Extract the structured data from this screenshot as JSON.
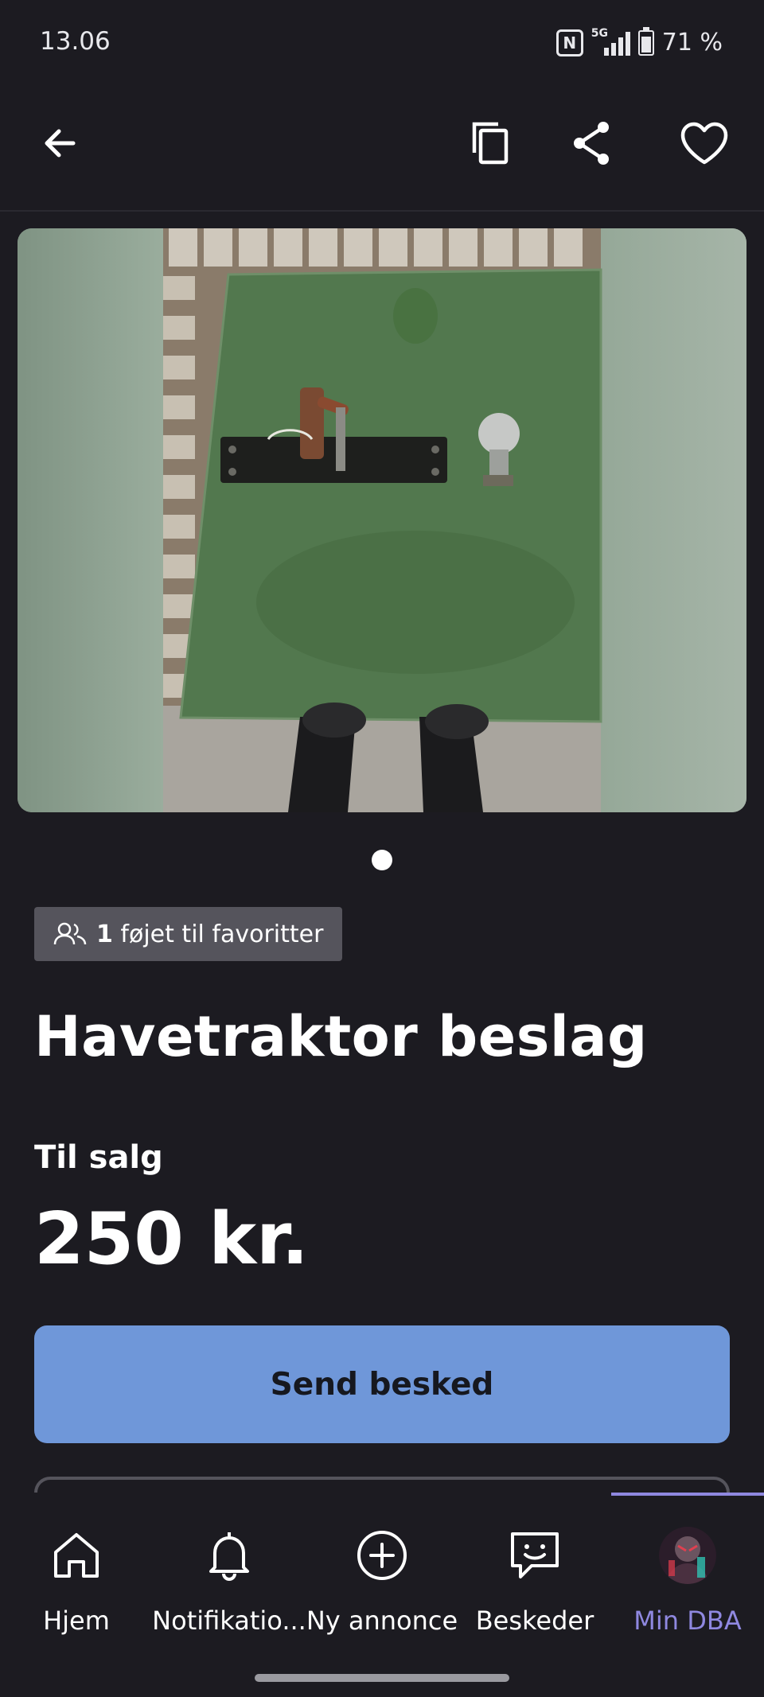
{
  "status_bar": {
    "time": "13.06",
    "network": "5G",
    "battery": "71 %",
    "battery_level_percent": 71
  },
  "toolbar": {
    "icons": [
      "back-arrow-icon",
      "copy-icon",
      "share-icon",
      "heart-icon"
    ]
  },
  "gallery": {
    "image_count": 1,
    "current_index": 1
  },
  "listing": {
    "favorites_count": "1",
    "favorites_text": "føjet til favoritter",
    "title": "Havetraktor beslag",
    "status": "Til salg",
    "price": "250 kr."
  },
  "actions": {
    "send_message": "Send besked"
  },
  "bottom_nav": {
    "items": [
      {
        "label": "Hjem",
        "icon": "home-icon"
      },
      {
        "label": "Notifikatio...",
        "icon": "bell-icon"
      },
      {
        "label": "Ny annonce",
        "icon": "plus-circle-icon"
      },
      {
        "label": "Beskeder",
        "icon": "message-icon"
      },
      {
        "label": "Min DBA",
        "icon": "avatar"
      }
    ],
    "active_index": 4
  },
  "colors": {
    "background": "#1c1b21",
    "primary_button": "#6f97d9",
    "accent": "#8f88e0",
    "badge": "#55545c"
  }
}
